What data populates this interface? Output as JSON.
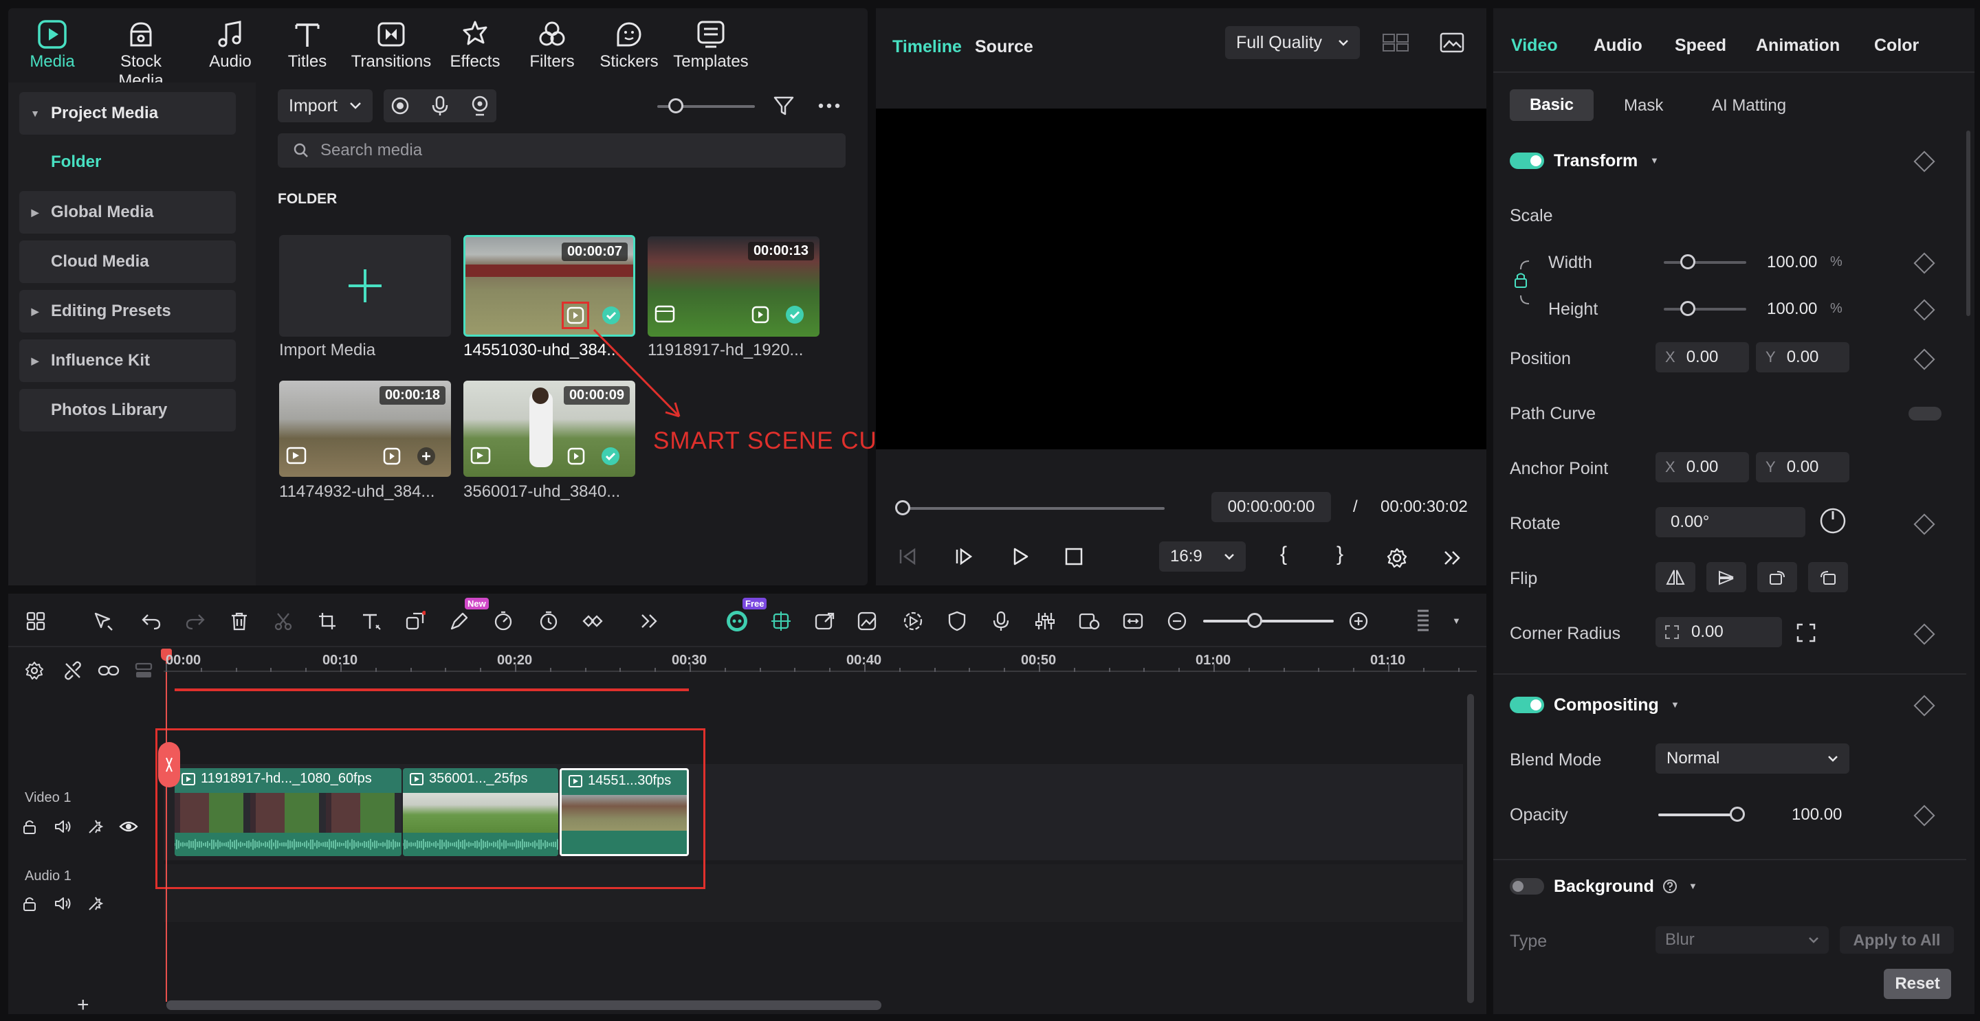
{
  "media_tabs": [
    {
      "id": "media",
      "label": "Media",
      "icon": "media-icon",
      "active": true
    },
    {
      "id": "stock",
      "label": "Stock Media",
      "icon": "stock-media-icon"
    },
    {
      "id": "audio",
      "label": "Audio",
      "icon": "music-note-icon"
    },
    {
      "id": "titles",
      "label": "Titles",
      "icon": "text-t-icon"
    },
    {
      "id": "transitions",
      "label": "Transitions",
      "icon": "transitions-icon"
    },
    {
      "id": "effects",
      "label": "Effects",
      "icon": "effects-icon"
    },
    {
      "id": "filters",
      "label": "Filters",
      "icon": "filters-icon"
    },
    {
      "id": "stickers",
      "label": "Stickers",
      "icon": "stickers-icon"
    },
    {
      "id": "templates",
      "label": "Templates",
      "icon": "templates-icon"
    }
  ],
  "left_nav": {
    "project_media": "Project Media",
    "folder": "Folder",
    "global_media": "Global Media",
    "cloud_media": "Cloud Media",
    "editing_presets": "Editing Presets",
    "influence_kit": "Influence Kit",
    "photos_library": "Photos Library"
  },
  "media_toolbar": {
    "import": "Import",
    "search_placeholder": "Search media"
  },
  "folder_heading": "FOLDER",
  "media_items": [
    {
      "name": "Import Media"
    },
    {
      "name": "14551030-uhd_384...",
      "duration": "00:00:07"
    },
    {
      "name": "11918917-hd_1920...",
      "duration": "00:00:13"
    },
    {
      "name": "11474932-uhd_384...",
      "duration": "00:00:18"
    },
    {
      "name": "3560017-uhd_3840...",
      "duration": "00:00:09"
    }
  ],
  "annotation": "SMART SCENE CUT",
  "preview": {
    "tab_timeline": "Timeline",
    "tab_source": "Source",
    "quality": "Full Quality",
    "current_time": "00:00:00:00",
    "separator": "/",
    "total_time": "00:00:30:02",
    "aspect": "16:9",
    "mark_in": "{",
    "mark_out": "}"
  },
  "props": {
    "tabs": [
      "Video",
      "Audio",
      "Speed",
      "Animation",
      "Color"
    ],
    "subtabs": [
      "Basic",
      "Mask",
      "AI Matting"
    ],
    "transform": "Transform",
    "scale": "Scale",
    "width": "Width",
    "width_val": "100.00",
    "height": "Height",
    "height_val": "100.00",
    "percent": "%",
    "position": "Position",
    "x": "X",
    "y": "Y",
    "pos_x": "0.00",
    "pos_y": "0.00",
    "path_curve": "Path Curve",
    "anchor": "Anchor Point",
    "anc_x": "0.00",
    "anc_y": "0.00",
    "rotate": "Rotate",
    "rotate_val": "0.00°",
    "flip": "Flip",
    "corner": "Corner Radius",
    "corner_val": "0.00",
    "compositing": "Compositing",
    "blend": "Blend Mode",
    "blend_val": "Normal",
    "opacity": "Opacity",
    "opacity_val": "100.00",
    "opacity_level": 1.0,
    "width_level": 0.0,
    "height_level": 0.0,
    "background": "Background",
    "type": "Type",
    "type_val": "Blur",
    "apply_all": "Apply to All",
    "reset": "Reset"
  },
  "timeline": {
    "ruler": [
      "00:00",
      "00:10",
      "00:20",
      "00:30",
      "00:40",
      "00:50",
      "01:00",
      "01:10"
    ],
    "badge_new": "New",
    "badge_free": "Free",
    "video_track": "Video 1",
    "audio_track": "Audio 1",
    "clips": [
      {
        "label": "11918917-hd..._1080_60fps"
      },
      {
        "label": "356001..._25fps"
      },
      {
        "label": "14551...30fps"
      }
    ],
    "add": "+"
  },
  "colors": {
    "accent": "#48e0c2",
    "annotation_red": "#e0302c"
  }
}
